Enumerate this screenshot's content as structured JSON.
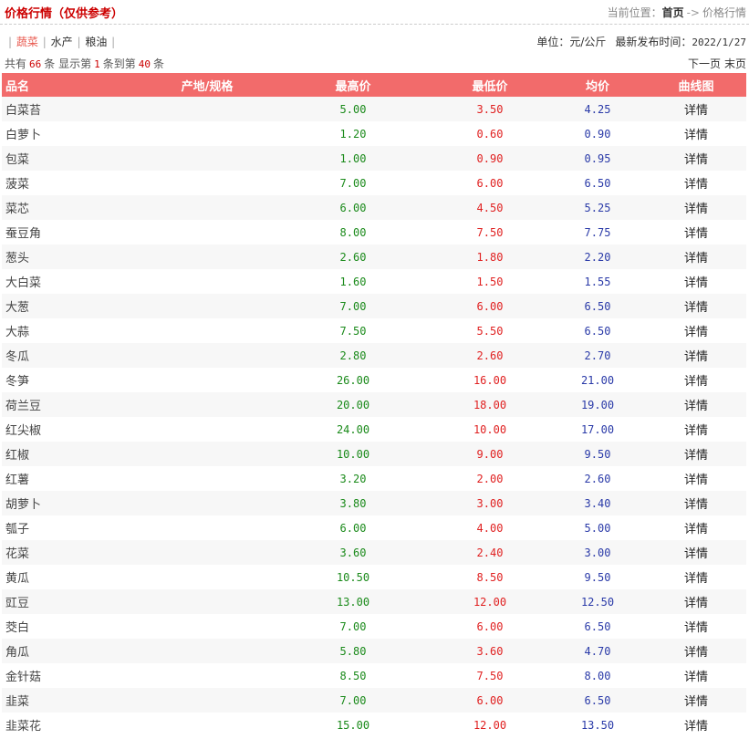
{
  "header": {
    "title": "价格行情（仅供参考）",
    "breadcrumb": {
      "label": "当前位置：",
      "home": "首页",
      "separator": "->",
      "current": "价格行情"
    }
  },
  "categories": {
    "separator": "|",
    "tabs": [
      "蔬菜",
      "水产",
      "粮油"
    ],
    "active_index": 0
  },
  "meta": {
    "unit_label": "单位：",
    "unit_value": "元/公斤",
    "release_label": "最新发布时间：",
    "release_value": "2022/1/27"
  },
  "pagination": {
    "total_prefix": "共有",
    "total": "66",
    "total_suffix": "条",
    "showing_prefix": "显示第",
    "from": "1",
    "to_label": "条到第",
    "to": "40",
    "to_suffix": "条",
    "next_label": "下一页",
    "last_label": "末页"
  },
  "table": {
    "columns": [
      "品名",
      "产地/规格",
      "最高价",
      "最低价",
      "均价",
      "曲线图"
    ],
    "detail_label": "详情",
    "rows": [
      {
        "name": "白菜苔",
        "origin": "",
        "high": "5.00",
        "low": "3.50",
        "avg": "4.25"
      },
      {
        "name": "白萝卜",
        "origin": "",
        "high": "1.20",
        "low": "0.60",
        "avg": "0.90"
      },
      {
        "name": "包菜",
        "origin": "",
        "high": "1.00",
        "low": "0.90",
        "avg": "0.95"
      },
      {
        "name": "菠菜",
        "origin": "",
        "high": "7.00",
        "low": "6.00",
        "avg": "6.50"
      },
      {
        "name": "菜芯",
        "origin": "",
        "high": "6.00",
        "low": "4.50",
        "avg": "5.25"
      },
      {
        "name": "蚕豆角",
        "origin": "",
        "high": "8.00",
        "low": "7.50",
        "avg": "7.75"
      },
      {
        "name": "葱头",
        "origin": "",
        "high": "2.60",
        "low": "1.80",
        "avg": "2.20"
      },
      {
        "name": "大白菜",
        "origin": "",
        "high": "1.60",
        "low": "1.50",
        "avg": "1.55"
      },
      {
        "name": "大葱",
        "origin": "",
        "high": "7.00",
        "low": "6.00",
        "avg": "6.50"
      },
      {
        "name": "大蒜",
        "origin": "",
        "high": "7.50",
        "low": "5.50",
        "avg": "6.50"
      },
      {
        "name": "冬瓜",
        "origin": "",
        "high": "2.80",
        "low": "2.60",
        "avg": "2.70"
      },
      {
        "name": "冬笋",
        "origin": "",
        "high": "26.00",
        "low": "16.00",
        "avg": "21.00"
      },
      {
        "name": "荷兰豆",
        "origin": "",
        "high": "20.00",
        "low": "18.00",
        "avg": "19.00"
      },
      {
        "name": "红尖椒",
        "origin": "",
        "high": "24.00",
        "low": "10.00",
        "avg": "17.00"
      },
      {
        "name": "红椒",
        "origin": "",
        "high": "10.00",
        "low": "9.00",
        "avg": "9.50"
      },
      {
        "name": "红薯",
        "origin": "",
        "high": "3.20",
        "low": "2.00",
        "avg": "2.60"
      },
      {
        "name": "胡萝卜",
        "origin": "",
        "high": "3.80",
        "low": "3.00",
        "avg": "3.40"
      },
      {
        "name": "瓠子",
        "origin": "",
        "high": "6.00",
        "low": "4.00",
        "avg": "5.00"
      },
      {
        "name": "花菜",
        "origin": "",
        "high": "3.60",
        "low": "2.40",
        "avg": "3.00"
      },
      {
        "name": "黄瓜",
        "origin": "",
        "high": "10.50",
        "low": "8.50",
        "avg": "9.50"
      },
      {
        "name": "豇豆",
        "origin": "",
        "high": "13.00",
        "low": "12.00",
        "avg": "12.50"
      },
      {
        "name": "茭白",
        "origin": "",
        "high": "7.00",
        "low": "6.00",
        "avg": "6.50"
      },
      {
        "name": "角瓜",
        "origin": "",
        "high": "5.80",
        "low": "3.60",
        "avg": "4.70"
      },
      {
        "name": "金针菇",
        "origin": "",
        "high": "8.50",
        "low": "7.50",
        "avg": "8.00"
      },
      {
        "name": "韭菜",
        "origin": "",
        "high": "7.00",
        "low": "6.00",
        "avg": "6.50"
      },
      {
        "name": "韭菜花",
        "origin": "",
        "high": "15.00",
        "low": "12.00",
        "avg": "13.50"
      }
    ]
  },
  "colors": {
    "title": "#cc0000",
    "header_bg": "#f26b6b",
    "active_tab": "#e8584e",
    "high_price": "#1a8a1a",
    "low_price": "#e02020",
    "avg_price": "#2a3aa8"
  }
}
